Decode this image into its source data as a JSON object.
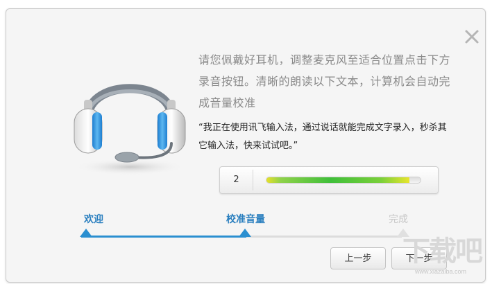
{
  "dialog": {
    "intro_text": "请您佩戴好耳机，调整麦克风至适合位置点击下方录音按钮。清晰的朗读以下文本，计算机会自动完成音量校准",
    "quote_text": "“我正在使用讯飞输入法，通过说话就能完成文字录入，秒杀其它输入法，快来试试吧。”",
    "close_icon": "close-icon",
    "headset_icon": "headset-icon"
  },
  "volume_meter": {
    "value": "2",
    "level_percent": 93
  },
  "steps": [
    {
      "label": "欢迎",
      "state": "done"
    },
    {
      "label": "校准音量",
      "state": "current"
    },
    {
      "label": "完成",
      "state": "pending"
    }
  ],
  "buttons": {
    "prev": "上一步",
    "next": "下一步"
  },
  "watermark": {
    "text": "下载吧",
    "url": "www.xiazaiba.com"
  },
  "colors": {
    "accent": "#2b8fd0",
    "step_label_active": "#2a7fbf",
    "step_label_inactive": "#c8c8c8"
  }
}
